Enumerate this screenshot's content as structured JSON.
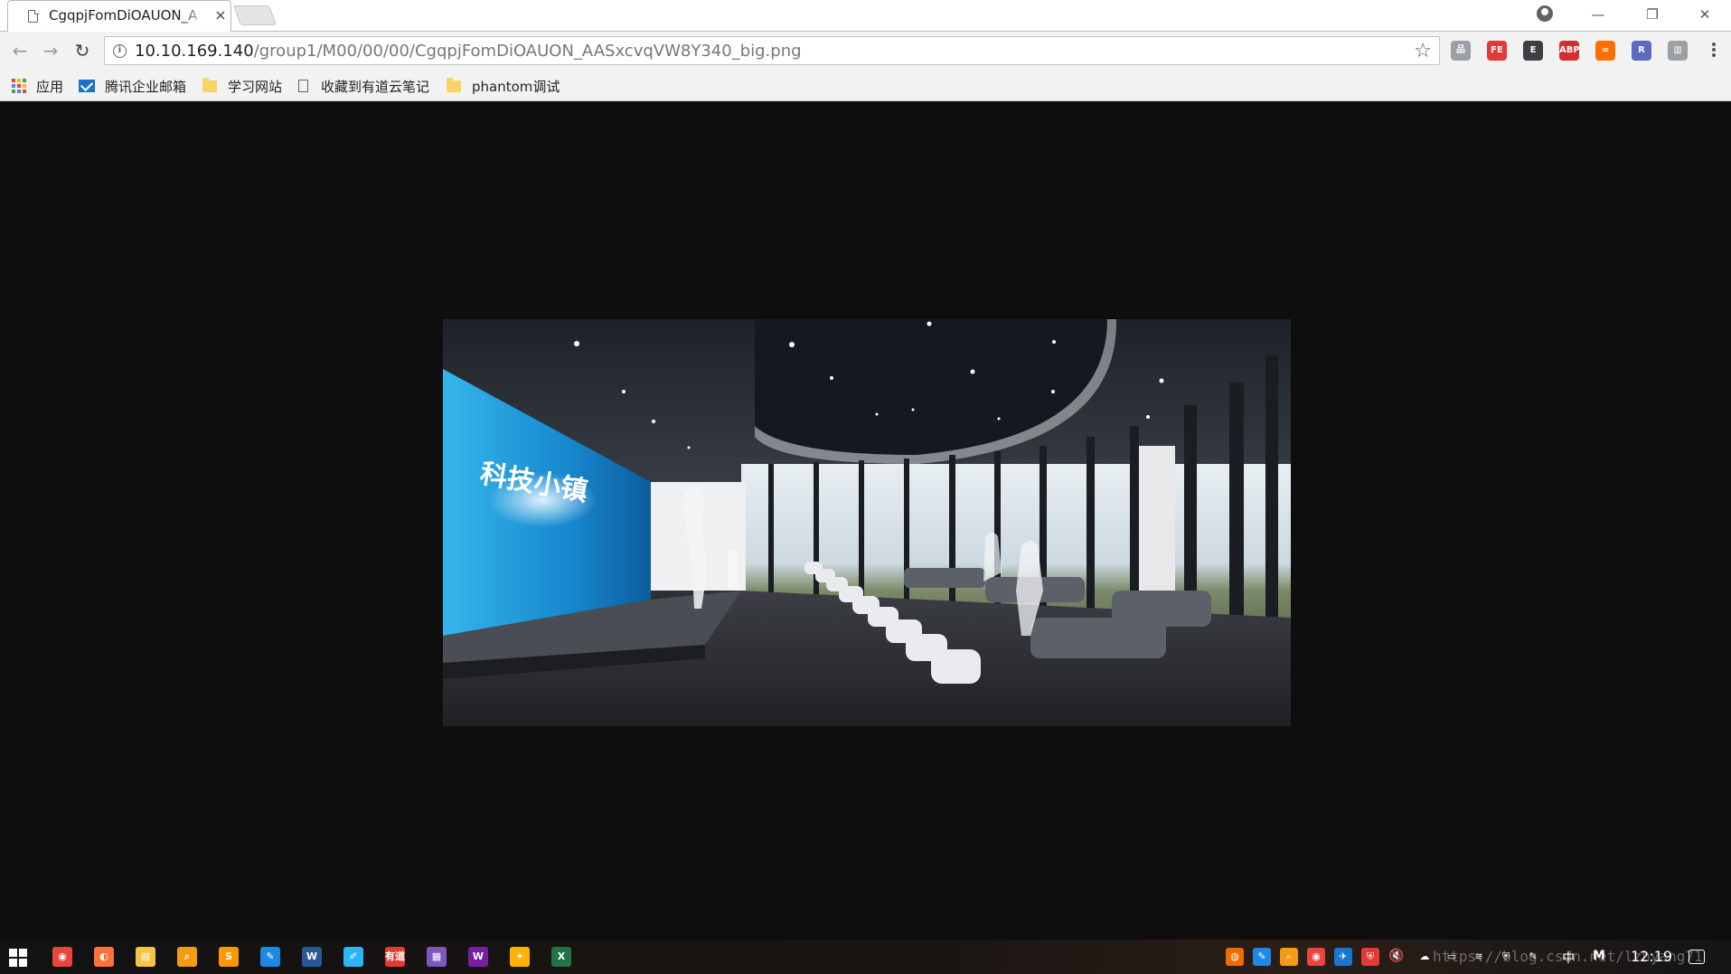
{
  "browser": {
    "tab": {
      "title": "CgqpjFomDiOAUON_A",
      "close_glyph": "×"
    },
    "window_controls": {
      "minimize": "—",
      "restore": "❐",
      "close": "✕"
    },
    "nav": {
      "back": "←",
      "forward": "→",
      "reload": "↻"
    },
    "address": {
      "host": "10.10.169.140",
      "path": "/group1/M00/00/00/CgqpjFomDiOAUON_AASxcvqVW8Y340_big.png",
      "info_glyph": "i",
      "star_glyph": "☆"
    },
    "extensions": [
      {
        "name": "sitemap-icon",
        "label": "品",
        "color": "#9aa0a6"
      },
      {
        "name": "fe-helper-icon",
        "label": "FE",
        "color": "#e53935"
      },
      {
        "name": "evernote-icon",
        "label": "E",
        "color": "#3c4043"
      },
      {
        "name": "adblock-plus-icon",
        "label": "ABP",
        "color": "#d32f2f"
      },
      {
        "name": "infinity-icon",
        "label": "∞",
        "color": "#ff6f00"
      },
      {
        "name": "react-devtools-icon",
        "label": "R",
        "color": "#5c6bc0"
      },
      {
        "name": "layout-icon",
        "label": "▥",
        "color": "#9aa0a6"
      }
    ],
    "bookmarks": [
      {
        "name": "bookmark-apps",
        "label": "应用"
      },
      {
        "name": "bookmark-tencent-mail",
        "label": "腾讯企业邮箱"
      },
      {
        "name": "bookmark-study-sites",
        "label": "学习网站"
      },
      {
        "name": "bookmark-youdao-note",
        "label": "收藏到有道云笔记"
      },
      {
        "name": "bookmark-phantom-debug",
        "label": "phantom调试"
      }
    ]
  },
  "image": {
    "screen_logo_text": "科技小镇"
  },
  "taskbar": {
    "apps": [
      {
        "name": "chrome-icon",
        "label": "◉",
        "color": "#e8453c"
      },
      {
        "name": "firefox-icon",
        "label": "◐",
        "color": "#ff7139"
      },
      {
        "name": "file-explorer-icon",
        "label": "▤",
        "color": "#f4c542"
      },
      {
        "name": "search-tool-icon",
        "label": "⌕",
        "color": "#f39c12"
      },
      {
        "name": "sublime-icon",
        "label": "S",
        "color": "#ff9800"
      },
      {
        "name": "feishu-icon",
        "label": "✎",
        "color": "#1e88e5"
      },
      {
        "name": "word-icon",
        "label": "W",
        "color": "#2b579a"
      },
      {
        "name": "pen-tool-icon",
        "label": "✐",
        "color": "#29b6f6"
      },
      {
        "name": "youdao-icon",
        "label": "有道",
        "color": "#e53935"
      },
      {
        "name": "palette-icon",
        "label": "▦",
        "color": "#7e57c2"
      },
      {
        "name": "webstorm-icon",
        "label": "W",
        "color": "#7b1fa2"
      },
      {
        "name": "paint-icon",
        "label": "✦",
        "color": "#ffb300"
      },
      {
        "name": "excel-icon",
        "label": "X",
        "color": "#217346"
      }
    ],
    "tray": [
      {
        "name": "tray-db-icon",
        "label": "◍",
        "color": "#ef6c00"
      },
      {
        "name": "tray-feishu-icon",
        "label": "✎",
        "color": "#1e88e5"
      },
      {
        "name": "tray-search-icon",
        "label": "⌕",
        "color": "#f39c12"
      },
      {
        "name": "tray-chrome-icon",
        "label": "◉",
        "color": "#e8453c"
      },
      {
        "name": "tray-bird-icon",
        "label": "✈",
        "color": "#1976d2"
      },
      {
        "name": "tray-security-icon",
        "label": "⛨",
        "color": "#e53935"
      }
    ],
    "mute_glyph": "🔇",
    "ime_text": "中",
    "ime_mode": "M",
    "time": "12:19",
    "watermark": "https://blog.csdn.net/lzhyang71"
  }
}
